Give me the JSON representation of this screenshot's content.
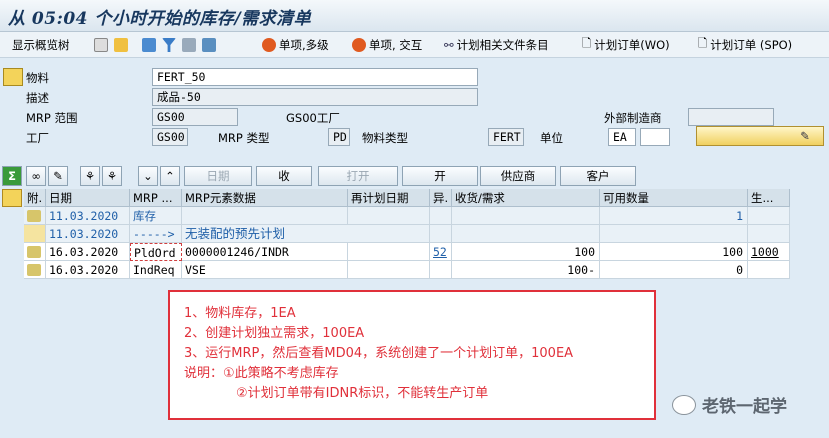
{
  "title": "从 05:04 个小时开始的库存/需求清单",
  "toolbar": {
    "items": [
      {
        "label": "显示概览树"
      },
      {
        "label": "单项,多级"
      },
      {
        "label": "单项, 交互"
      },
      {
        "label": "计划相关文件条目"
      },
      {
        "label": "计划订单(WO)"
      },
      {
        "label": "计划订单 (SPO)"
      }
    ]
  },
  "header": {
    "material_label": "物料",
    "material_value": "FERT_50",
    "desc_label": "描述",
    "desc_value": "成品-50",
    "mrp_area_label": "MRP 范围",
    "mrp_area_value": "GS00",
    "mrp_area_text": "GS00工厂",
    "ext_mfr_label": "外部制造商",
    "plant_label": "工厂",
    "plant_value": "GS00",
    "mrp_type_label": "MRP 类型",
    "mrp_type_value": "PD",
    "mat_type_label": "物料类型",
    "mat_type_value": "FERT",
    "unit_label": "单位",
    "unit_value": "EA"
  },
  "buttons": {
    "date": "日期",
    "open": "打开",
    "receive": "收",
    "open2": "开",
    "vendor": "供应商",
    "customer": "客户"
  },
  "grid": {
    "headers": [
      "附.",
      "日期",
      "MRP ...",
      "MRP元素数据",
      "再计划日期",
      "异.",
      "收货/需求",
      "可用数量",
      "生..."
    ],
    "rows": [
      {
        "date": "11.03.2020",
        "elem": "库存",
        "data": "",
        "resched": "",
        "exc": "",
        "qty": "",
        "avail": "1",
        "prod": "",
        "blue": true
      },
      {
        "date": "11.03.2020",
        "elem": "----->",
        "data": "无装配的预先计划",
        "resched": "",
        "exc": "",
        "qty": "",
        "avail": "",
        "prod": "",
        "blue": true
      },
      {
        "date": "16.03.2020",
        "elem": "PldOrd",
        "data": "0000001246/INDR",
        "resched": "",
        "exc": "52",
        "qty": "100",
        "avail": "100",
        "prod": "1000",
        "blue": false
      },
      {
        "date": "16.03.2020",
        "elem": "IndReq",
        "data": "VSE",
        "resched": "",
        "exc": "",
        "qty": "100-",
        "avail": "0",
        "prod": "",
        "blue": false
      }
    ]
  },
  "note": {
    "lines": [
      "1、物料库存，1EA",
      "2、创建计划独立需求，100EA",
      "3、运行MRP，然后查看MD04，系统创建了一个计划订单，100EA",
      "说明：①此策略不考虑库存",
      "②计划订单带有IDNR标识，不能转生产订单"
    ]
  },
  "watermark": "老铁一起学",
  "colors": {
    "note_red": "#e0303a",
    "link_blue": "#1f5fa8"
  }
}
